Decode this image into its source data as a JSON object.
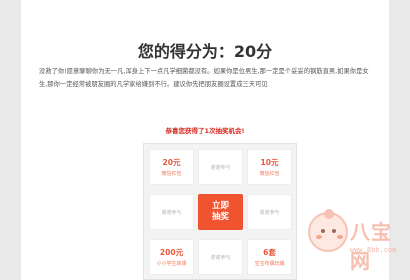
{
  "score": {
    "title": "您的得分为：20分",
    "description": "没救了你!愿意聊聊你为无一凡,浑身上下一点凡学细菌都没有。如果你是位男生,那一定是个妥妥的钢筋直男,如果你是女生,那你一定经常被朋友圈的凡学家给嫌到不行。建议你先把朋友圈设置成三天可见"
  },
  "lottery": {
    "win_label": "恭喜您获得了1次抽奖机会!",
    "cells": [
      {
        "big": "20元",
        "small": "微信红包"
      },
      {
        "plain": "谢谢参与"
      },
      {
        "big": "10元",
        "small": "微信红包"
      },
      {
        "plain": "谢谢参与"
      },
      {
        "plain": "谢谢参与"
      },
      {
        "big": "200元",
        "small": "小小学生四课"
      },
      {
        "plain": "谢谢参与"
      },
      {
        "big": "6套",
        "small": "宝宝布偶玩偶"
      }
    ],
    "draw_button": [
      "立即",
      "抽奖"
    ]
  },
  "watermark": {
    "text": "八宝网",
    "url": "www.8bb.com"
  }
}
